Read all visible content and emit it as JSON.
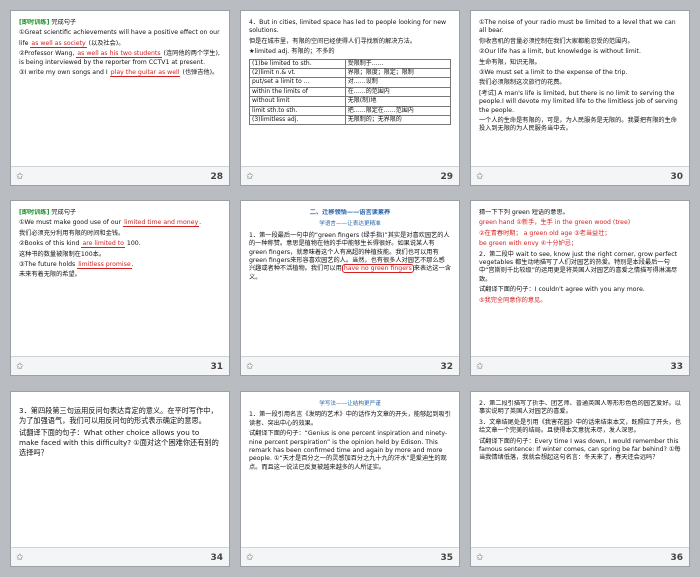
{
  "slides": [
    {
      "num": "28",
      "tag": "[即时训练]",
      "title": "完成句子",
      "lines": [
        {
          "pre": "①Great scientific achievements will have a positive effect on our",
          "blank": "",
          "post": ""
        },
        {
          "pre": "life",
          "blank": "as well as society",
          "post": "(以及社会)。"
        },
        {
          "pre": "②Professor Wang,",
          "blank": "as well as his two students",
          "post": "(连同他的两个学生), is being interviewed by the reporter from CCTV1 at present."
        },
        {
          "pre": "③I write my own songs and I",
          "blank": "play the guitar as well",
          "post": "(也弹吉他)。"
        }
      ]
    },
    {
      "num": "29",
      "intro": "4．But in cities, limited space has led to people looking for new solutions.",
      "intro_cn": "但是在城市里，有限的空间已经使得人们寻找新的解决方法。",
      "table_head": "★limited adj. 有限的；不多的",
      "rows": [
        [
          "(1)be limited to sth.",
          "受限制于……"
        ],
        [
          "(2)limit n.& vt.",
          "界限；限度；限定；限制"
        ],
        [
          "put/set a limit to ...",
          "对……设制"
        ],
        [
          "within the limits of",
          "在……的范围内"
        ],
        [
          "without limit",
          "无限(制)地"
        ],
        [
          "limit sth.to sth.",
          "把……限定在……范围内"
        ],
        [
          "(3)limitless adj.",
          "无限制的；无界限的"
        ]
      ]
    },
    {
      "num": "30",
      "lines": [
        "①The noise of your radio must be limited to a level that we can all bear.",
        "你收音机的音量必须控制在我们大家都能忍受的范围内。",
        "②Our life has a limit, but knowledge is without limit.",
        "生命有限，知识无限。",
        "③We must set a limit to the expense of the trip.",
        "我们必须限制这次旅行的花费。",
        "[考试] A man's life is limited, but there is no limit to serving the people.I will devote my limited life to the limitless job of serving the people.",
        "一个人的生命是有限的，可是，为人民服务是无限的。我要把有限的生命投入到无限的为人民服务当中去。"
      ]
    },
    {
      "num": "31",
      "tag": "[即时训练]",
      "title": "完成句子",
      "lines": [
        {
          "pre": "①We must make good use of our",
          "blank": "limited time and money",
          "post": "."
        },
        {
          "pre": "我们必须充分利用有限的时间和金钱。",
          "blank": "",
          "post": ""
        },
        {
          "pre": "②Books of this kind",
          "blank": "are limited to",
          "post": "100."
        },
        {
          "pre": "这种书的数量被限制在100本。",
          "blank": "",
          "post": ""
        },
        {
          "pre": "③The future holds",
          "blank": "limitless promise",
          "post": "."
        },
        {
          "pre": "未来有着无限的希望。",
          "blank": "",
          "post": ""
        }
      ]
    },
    {
      "num": "32",
      "section": "二、迁移领悟——语言读累养",
      "sub": "学语言——让表达更精准",
      "para": "1．第一段最后一句中的“green fingers (绿手指)”其实是对喜欢园艺的人的一种称赞。意思是植物在他的手中能够生长得很好。如果说某人有green fingers，就意味着这个人有高超的种植技能。我们也可以用有green fingers来形容喜欢园艺的人。当然，也有很多人对园艺不那么感兴趣或者种不活植物。我们可以用",
      "blank": "have no green fingers",
      "post": "来表达这一含义。"
    },
    {
      "num": "33",
      "lines": [
        "猜一下下列 green 短语的意思。",
        "green hand ①新手，生手    in the green wood (tree)",
        "②在青春时期；    a green old age ③老当益壮；",
        "be green with envy ④十分妒忌；",
        "2．第二段中 wait to see, know just the right corner, grow perfect vegetables 都生动地描写了人们对园艺的热爱。特别是本段最后一句中“宫斯则千比较级”的运用更是将英国人对园艺的喜爱之情描写得淋漓尽致。",
        "试翻译下面的句子：I couldn't agree with you any more.",
        "⑤我完全同意你的意见。"
      ]
    },
    {
      "num": "34",
      "lines": [
        "3．第四段第三句运用反问句表达肯定的意义。在平时写作中，为了加强语气，我们可以用反问句的形式表示确定的意思。",
        "试翻译下面的句子：What other choice allows you to make faced with this difficulty? ①面对这个困难你还有别的选择吗？"
      ]
    },
    {
      "num": "35",
      "sub": "学写法——让结构更严谨",
      "lines": [
        "1．第一段引用名言《发明的艺术》中的话作为文章的开头，能够起到吸引读者、突出中心的效果。",
        "试翻译下面的句子：“Genius is one percent inspiration and ninety-nine percent perspiration” is the opinion held by Edison. This remark has been confirmed time and again by more and more people. ①“天才是百分之一的灵感加百分之九十九的汗水”是爱迪生的观点。而且这一说法已反复被越来越多的人所证实。"
      ]
    },
    {
      "num": "36",
      "lines": [
        "2．第二段引描写了折手、团艺师、普通英国人等形形色色的园艺爱好。以事实说明了英国人对园艺的喜爱。",
        "3．文章结尾处是引用《我害花园》中的话来结束本文，既照应了开头，也给文章一个完美的结局。且使得本文意犹未尽，发人深思。",
        "试翻译下面的句子：Every time I was down, I would remember this famous sentence: If winter comes, can spring be far behind? ①每当我情绪低落，我就会想起这句名言：冬天来了，春天还会远吗？"
      ]
    }
  ]
}
